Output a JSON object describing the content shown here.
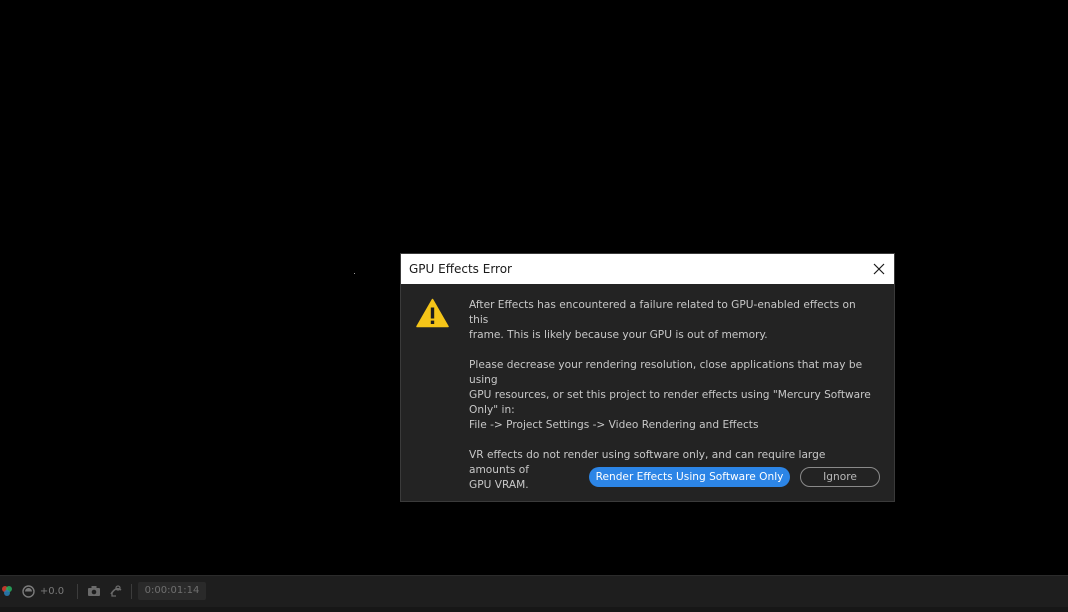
{
  "dialog": {
    "title": "GPU Effects Error",
    "paragraphs": [
      "After Effects has encountered a failure related to GPU-enabled effects on this\nframe. This is likely because your GPU is out of memory.",
      "Please decrease your rendering resolution, close applications that may be using\nGPU resources, or set this project to render effects using \"Mercury Software\nOnly\" in:\nFile -> Project Settings -> Video Rendering and Effects",
      "VR effects do not render using software only, and can require large amounts of\nGPU VRAM."
    ],
    "primary_button": "Render Effects Using Software Only",
    "secondary_button": "Ignore",
    "icon": "warning-icon"
  },
  "toolbar": {
    "exposure_value": "+0.0",
    "timecode": "0:00:01:14",
    "icons": [
      "color-channel-icon",
      "reset-exposure-icon",
      "snapshot-camera-icon",
      "show-snapshot-icon"
    ]
  },
  "colors": {
    "accent": "#2c85e6",
    "dialog_bg": "#232323",
    "warning": "#f5c518"
  }
}
